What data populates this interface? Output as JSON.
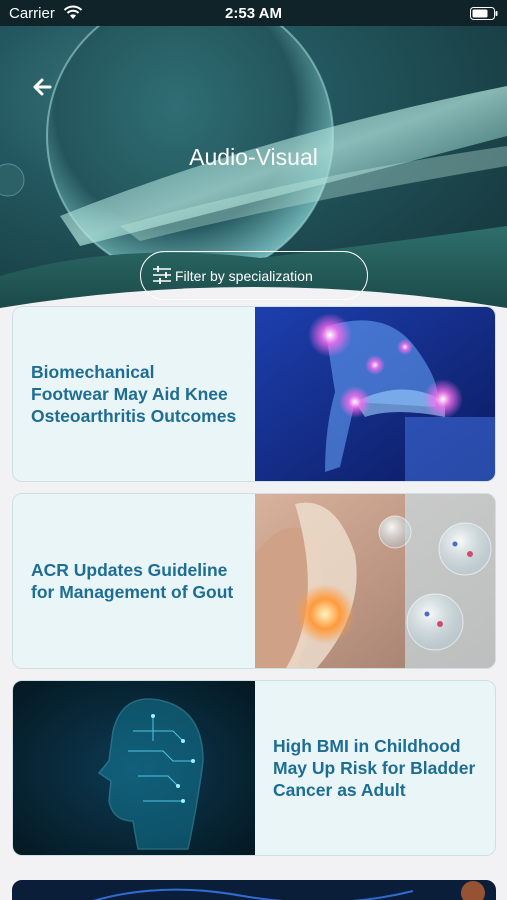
{
  "status_bar": {
    "carrier": "Carrier",
    "time": "2:53 AM"
  },
  "header": {
    "title": "Audio-Visual",
    "back_icon": "back-arrow-icon",
    "filter_label": "Filter by specialization",
    "filter_icon": "sliders-icon"
  },
  "articles": [
    {
      "title": "Biomechanical Footwear May Aid Knee Osteoarthritis Outcomes",
      "image": "glowing knee skeleton illustration"
    },
    {
      "title": "ACR Updates Guideline for Management of Gout",
      "image": "gout joint crystals illustration"
    },
    {
      "title": "High BMI in Childhood May Up Risk for Bladder Cancer as Adult",
      "image": "digital head circuit illustration"
    }
  ],
  "colors": {
    "title_text": "#1d6d95",
    "card_background": "#eaf5f7",
    "page_background": "#f2f2f4",
    "header_background": "#23575f"
  }
}
